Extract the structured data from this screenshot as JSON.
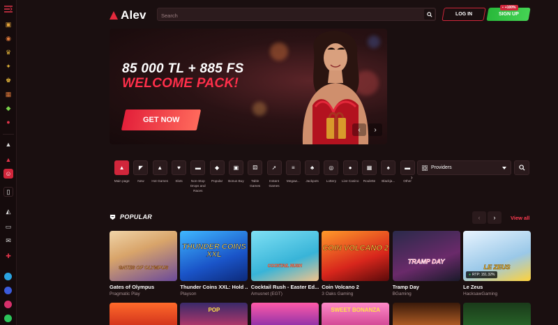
{
  "brand": {
    "name": "Alev"
  },
  "header": {
    "search_placeholder": "Search",
    "login_label": "LOG IN",
    "signup_label": "SIGN UP",
    "signup_badge": "+100%"
  },
  "hero": {
    "headline": "85 000 TL + 885 FS",
    "subheadline": "WELCOME PACK!",
    "cta_label": "GET NOW",
    "prev": "‹",
    "next": "›"
  },
  "categories": [
    {
      "label": "Main page",
      "icon": "flame-icon",
      "active": true
    },
    {
      "label": "New",
      "icon": "megaphone-icon"
    },
    {
      "label": "Hot Games",
      "icon": "fire-icon"
    },
    {
      "label": "Slots",
      "icon": "heart-icon"
    },
    {
      "label": "Non-Stop Drops and Races",
      "icon": "hat-icon"
    },
    {
      "label": "Popular",
      "icon": "shield-icon"
    },
    {
      "label": "Bonus Buy",
      "icon": "gift-icon"
    },
    {
      "label": "Table Games",
      "icon": "dice-icon"
    },
    {
      "label": "Instant Games",
      "icon": "rocket-icon"
    },
    {
      "label": "Megaw...",
      "icon": "bars-icon"
    },
    {
      "label": "Jackpots",
      "icon": "cherry-icon"
    },
    {
      "label": "Lottery",
      "icon": "coin-icon"
    },
    {
      "label": "Live Casino",
      "icon": "chip-icon"
    },
    {
      "label": "Roulette",
      "icon": "grid-icon"
    },
    {
      "label": "Blackja...",
      "icon": "spade-icon"
    },
    {
      "label": "Other",
      "icon": "hat-icon"
    }
  ],
  "providers": {
    "label": "Providers"
  },
  "popular": {
    "title": "POPULAR",
    "view_all": "View all",
    "games": [
      {
        "name": "Gates of Olympus",
        "provider": "Pragmatic Play",
        "art": "GATES OF OLYMPUS"
      },
      {
        "name": "Thunder Coins XXL: Hold ...",
        "provider": "Playson",
        "art": "THUNDER COINS XXL"
      },
      {
        "name": "Cocktail Rush - Easter Ed...",
        "provider": "Amusnet (EGT)",
        "art": "COCKTAIL RUSH"
      },
      {
        "name": "Coin Volcano 2",
        "provider": "3 Oaks Gaming",
        "art": "COIN VOLCANO 2"
      },
      {
        "name": "Tramp Day",
        "provider": "BGaming",
        "art": "TRAMP DAY"
      },
      {
        "name": "Le Zeus",
        "provider": "HacksawGaming",
        "art": "LE ZEUS",
        "rtp": "RTP: 151.32%"
      }
    ],
    "next_row_art": [
      "",
      "POP",
      "",
      "SWEET BONANZA",
      "",
      ""
    ]
  }
}
